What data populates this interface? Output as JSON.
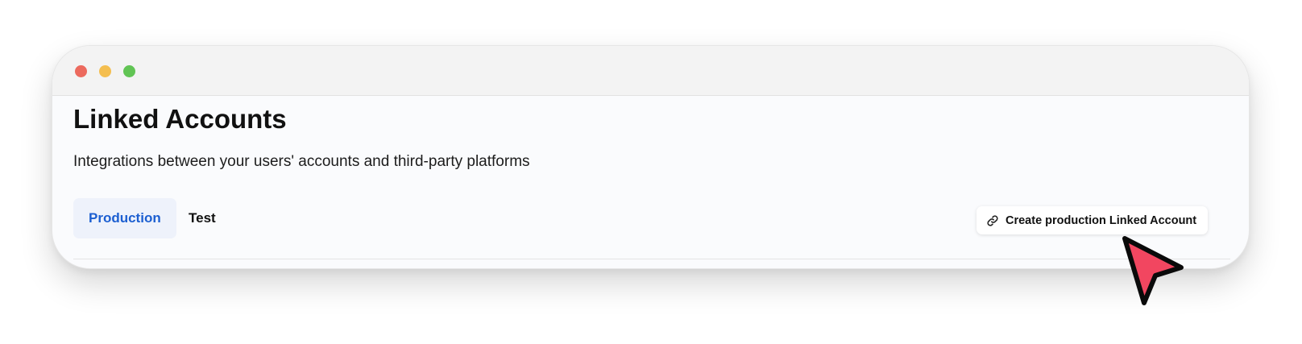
{
  "window": {
    "controls": [
      {
        "name": "close",
        "color": "#ec6a5e"
      },
      {
        "name": "minimize",
        "color": "#f4be4f"
      },
      {
        "name": "maximize",
        "color": "#61c454"
      }
    ]
  },
  "page": {
    "title": "Linked Accounts",
    "subtitle": "Integrations between your users' accounts and third-party platforms"
  },
  "tabs": [
    {
      "label": "Production",
      "active": true,
      "color": "#1c5fd1"
    },
    {
      "label": "Test",
      "active": false
    }
  ],
  "actions": {
    "create_label": "Create production Linked Account",
    "create_icon": "link-icon"
  },
  "cursor": {
    "icon": "pointer-arrow-icon",
    "color": "#f24660"
  }
}
